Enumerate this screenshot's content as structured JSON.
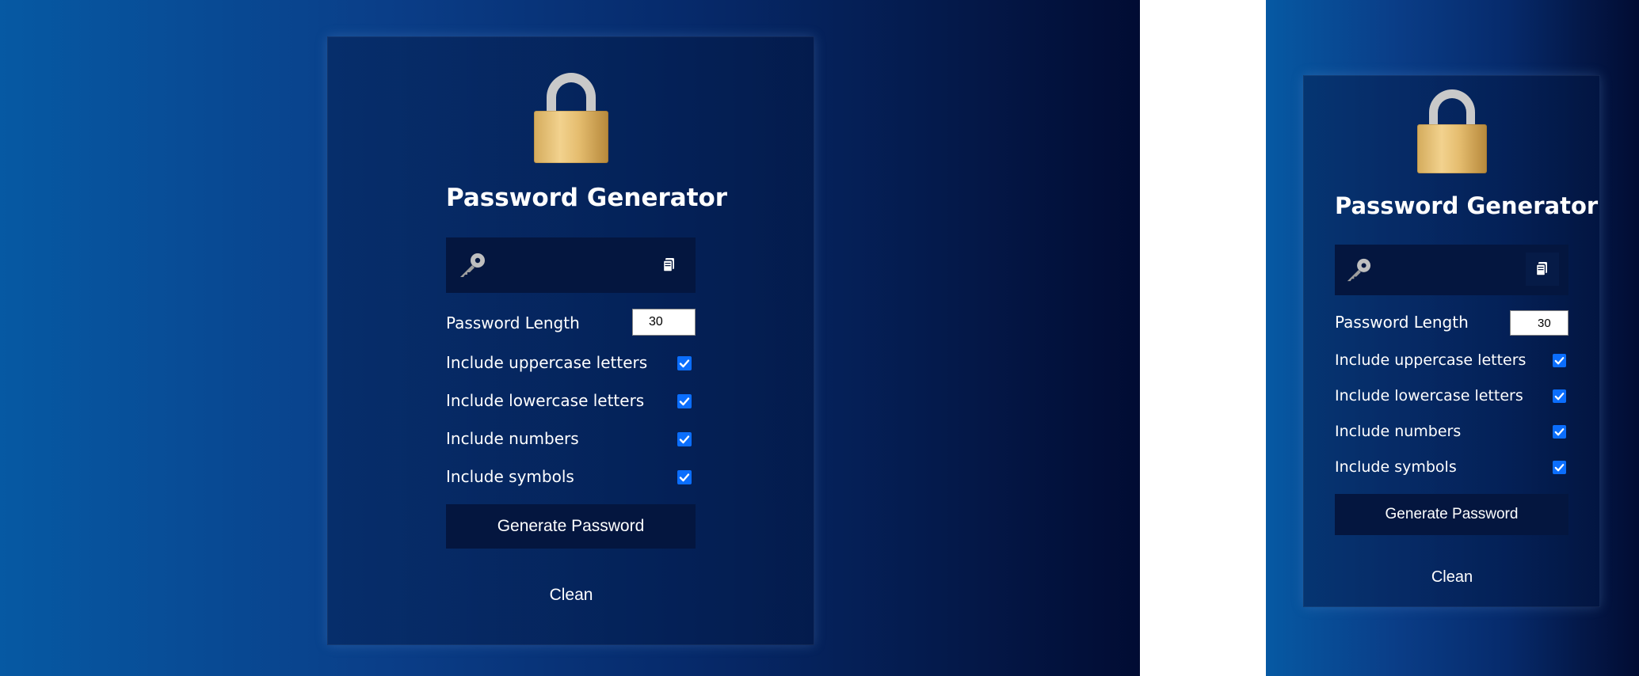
{
  "title": "Password Generator",
  "password": {
    "value": "",
    "key_icon": "key-icon",
    "copy_icon": "clipboard-icon"
  },
  "length": {
    "label": "Password Length",
    "value": "30"
  },
  "options": [
    {
      "label": "Include uppercase letters",
      "checked": true
    },
    {
      "label": "Include lowercase letters",
      "checked": true
    },
    {
      "label": "Include numbers",
      "checked": true
    },
    {
      "label": "Include symbols",
      "checked": true
    }
  ],
  "generate_label": "Generate Password",
  "clean_label": "Clean",
  "colors": {
    "checkbox_accent": "#0b6efd",
    "field_background": "#04163f",
    "lock_gold": "#e5bd6f"
  }
}
